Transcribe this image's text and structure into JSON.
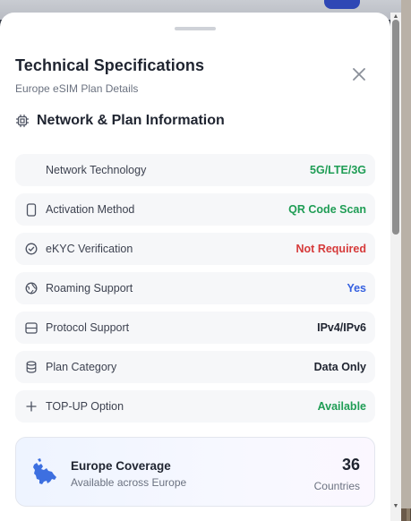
{
  "sheet": {
    "title": "Technical Specifications",
    "subtitle": "Europe eSIM Plan Details",
    "close_icon": "close-icon"
  },
  "section": {
    "icon": "chip-icon",
    "title": "Network & Plan Information"
  },
  "specs": [
    {
      "icon": "",
      "label": "Network Technology",
      "value": "5G/LTE/3G",
      "color": "#1f9d55"
    },
    {
      "icon": "phone-icon",
      "label": "Activation Method",
      "value": "QR Code Scan",
      "color": "#1f9d55"
    },
    {
      "icon": "check-circle-icon",
      "label": "eKYC Verification",
      "value": "Not Required",
      "color": "#d63a3a"
    },
    {
      "icon": "globe-icon",
      "label": "Roaming Support",
      "value": "Yes",
      "color": "#3560e0"
    },
    {
      "icon": "server-icon",
      "label": "Protocol Support",
      "value": "IPv4/IPv6",
      "color": "#1f2430"
    },
    {
      "icon": "database-icon",
      "label": "Plan Category",
      "value": "Data Only",
      "color": "#1f2430"
    },
    {
      "icon": "plus-icon",
      "label": "TOP-UP Option",
      "value": "Available",
      "color": "#1f9d55"
    }
  ],
  "coverage": {
    "icon": "europe-map-icon",
    "title": "Europe Coverage",
    "subtitle": "Available across Europe",
    "count": "36",
    "unit": "Countries"
  },
  "colors": {
    "accent_blue": "#3560e0",
    "success_green": "#1f9d55",
    "danger_red": "#d63a3a"
  }
}
